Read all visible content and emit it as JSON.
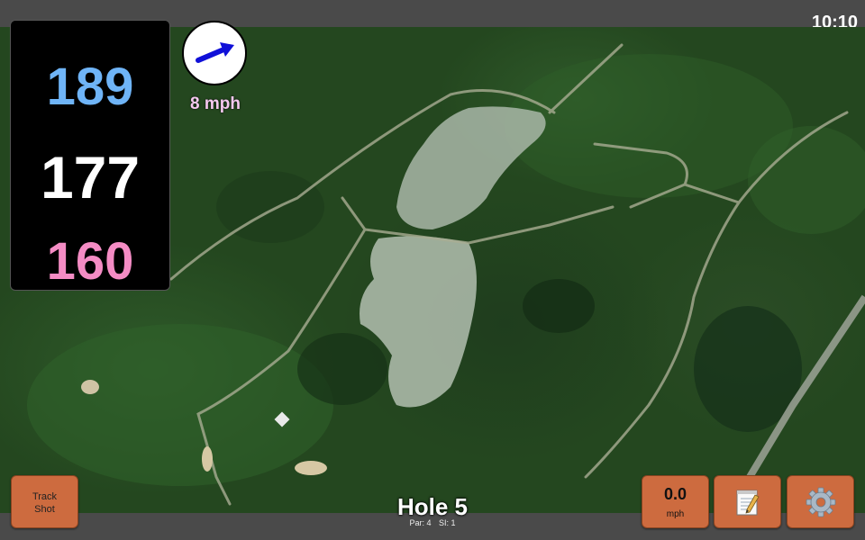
{
  "status_bar": {
    "time": "10:10"
  },
  "distances": {
    "back": "189",
    "center": "177",
    "front": "160"
  },
  "wind": {
    "speed_label": "8 mph",
    "direction_icon": "arrow-up-right-icon"
  },
  "buttons": {
    "track_shot": "Track\nShot",
    "wind_value": "0.0",
    "wind_unit": "mph",
    "notes_icon": "notepad-icon",
    "settings_icon": "gear-icon"
  },
  "hole": {
    "title": "Hole 5",
    "par": "Par: 4",
    "si": "SI: 1"
  },
  "colors": {
    "back_distance": "#6fb4f7",
    "center_distance": "#ffffff",
    "front_distance": "#f48cc4",
    "button_orange": "#cd6b3f",
    "wind_label": "#f5c8ef",
    "arrow": "#1010d8"
  }
}
